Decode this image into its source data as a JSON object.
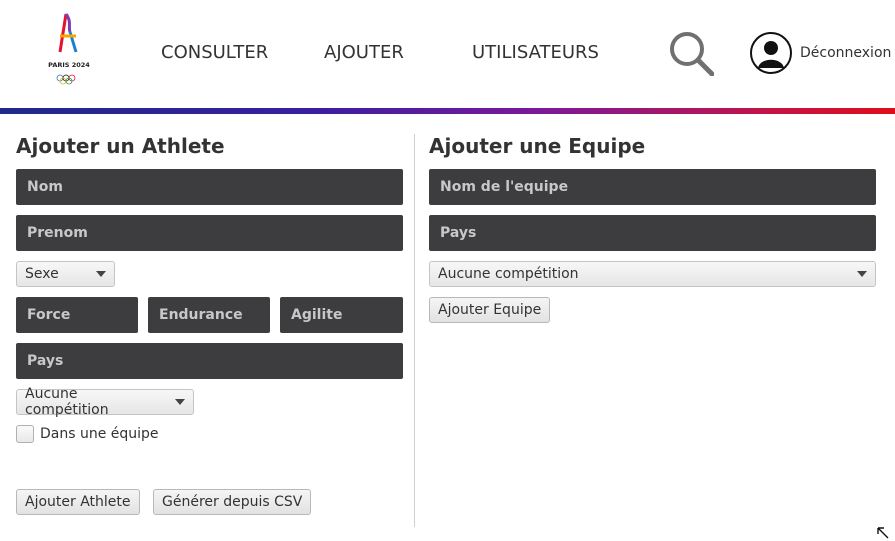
{
  "header": {
    "logo_text": "PARIS 2024",
    "nav": [
      "CONSULTER",
      "AJOUTER",
      "UTILISATEURS"
    ],
    "logout_label": "Déconnexion"
  },
  "athlete_form": {
    "title": "Ajouter un Athlete",
    "nom_placeholder": "Nom",
    "prenom_placeholder": "Prenom",
    "sexe_selected": "Sexe",
    "force_placeholder": "Force",
    "endurance_placeholder": "Endurance",
    "agilite_placeholder": "Agilite",
    "pays_placeholder": "Pays",
    "competition_selected": "Aucune compétition",
    "team_checkbox_label": "Dans une équipe",
    "team_checkbox_checked": false,
    "add_button": "Ajouter Athlete",
    "csv_button": "Générer depuis CSV"
  },
  "team_form": {
    "title": "Ajouter une Equipe",
    "team_name_placeholder": "Nom de l'equipe",
    "pays_placeholder": "Pays",
    "competition_selected": "Aucune compétition",
    "add_button": "Ajouter Equipe"
  },
  "colors": {
    "field_bg": "#3d3d3f",
    "gradient_start": "#1f2a8a",
    "gradient_end": "#e00d1a"
  }
}
